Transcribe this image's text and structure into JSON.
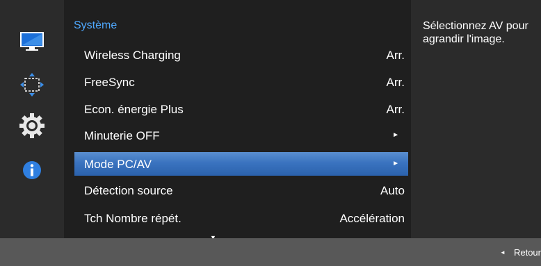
{
  "menu": {
    "section_title": "Système",
    "items": [
      {
        "label": "Wireless Charging",
        "value": "Arr."
      },
      {
        "label": "FreeSync",
        "value": "Arr."
      },
      {
        "label": "Econ. énergie Plus",
        "value": "Arr."
      },
      {
        "label": "Minuterie OFF",
        "value": "►"
      },
      {
        "label": "Mode PC/AV",
        "value": "►",
        "selected": true
      },
      {
        "label": "Détection source",
        "value": "Auto"
      },
      {
        "label": "Tch Nombre répét.",
        "value": "Accélération"
      }
    ],
    "scroll_indicator": "▼"
  },
  "help": {
    "text": "Sélectionnez AV pour agrandir l'image."
  },
  "bottom_bar": {
    "back_arrow": "◄",
    "back_label": "Retour"
  },
  "sidebar": {
    "icons": [
      "picture-icon",
      "position-icon",
      "settings-gear-icon",
      "info-icon"
    ],
    "active_icon": "settings-gear-icon"
  },
  "colors": {
    "accent": "#4fa9ff",
    "selected_bar": "#3a73bf"
  }
}
